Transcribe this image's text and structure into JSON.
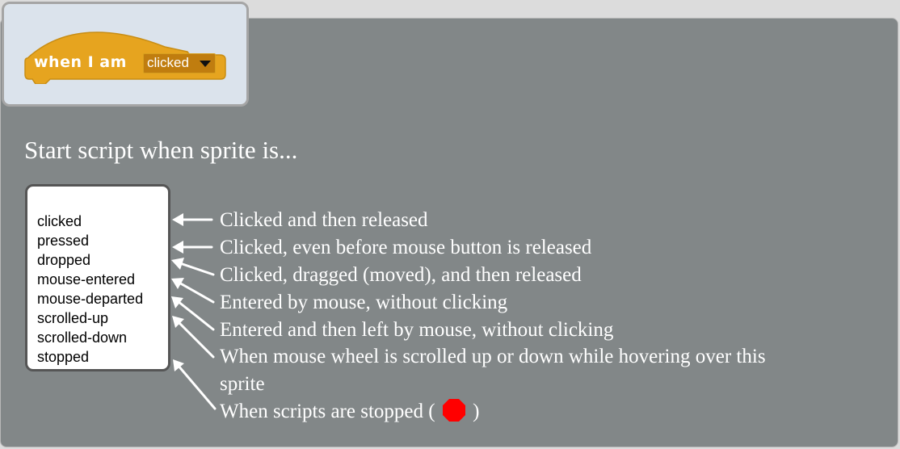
{
  "block": {
    "prefix": "when I am",
    "selected": "clicked",
    "color": "#e6a41f"
  },
  "heading": "Start script when sprite is...",
  "options": [
    "clicked",
    "pressed",
    "dropped",
    "mouse-entered",
    "mouse-departed",
    "scrolled-up",
    "scrolled-down",
    "stopped"
  ],
  "descriptions": [
    "Clicked and then released",
    "Clicked, even before mouse button is released",
    "Clicked, dragged (moved), and then released",
    "Entered by mouse, without clicking",
    "Entered and then left by mouse, without clicking",
    "When mouse wheel is scrolled up or down while hovering over this",
    "sprite"
  ],
  "stopped_description": {
    "before": "When scripts are stopped (",
    "after": ")",
    "icon": "stop-sign-icon",
    "icon_color": "#ff0000"
  }
}
